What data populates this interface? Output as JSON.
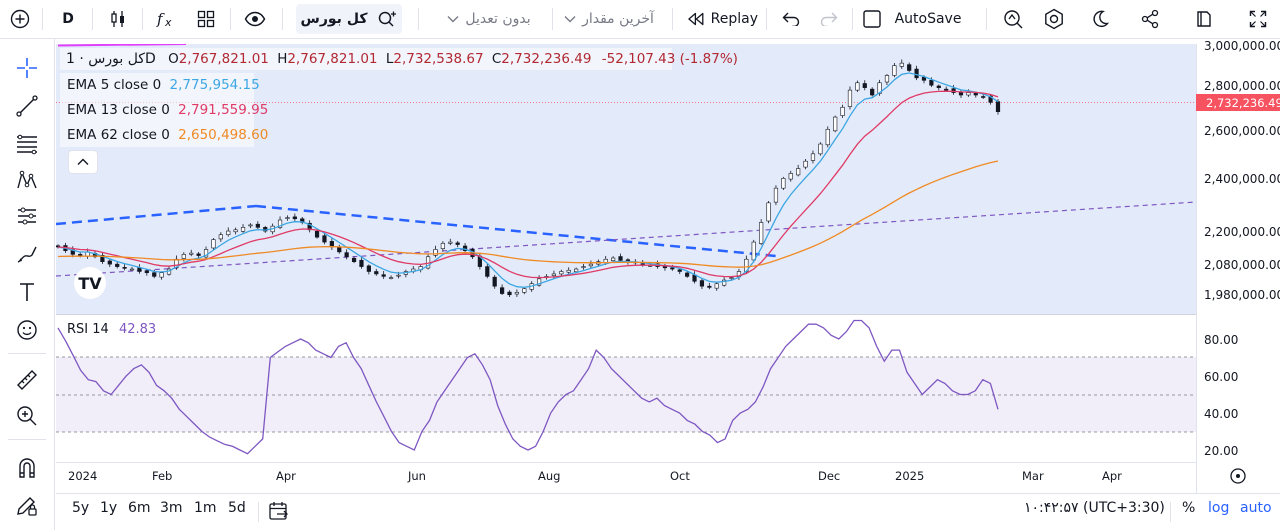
{
  "toolbar": {
    "interval": "D",
    "symbol": "کل بورس",
    "price_type": "بدون تعدیل",
    "last_value": "آخرین مقدار",
    "replay": "Replay",
    "autosave": "AutoSave"
  },
  "legend": {
    "title": "کل بورس · 1D",
    "ohlc": [
      {
        "label": "O",
        "value": "2,767,821.01"
      },
      {
        "label": "H",
        "value": "2,767,821.01"
      },
      {
        "label": "L",
        "value": "2,732,538.67"
      },
      {
        "label": "C",
        "value": "2,732,236.49"
      }
    ],
    "change": "-52,107.43 (-1.87%)",
    "ema": [
      {
        "label": "EMA 5 close 0",
        "value": "2,775,954.15",
        "color": "#3da7e3"
      },
      {
        "label": "EMA 13 close 0",
        "value": "2,791,559.95",
        "color": "#e03a66"
      },
      {
        "label": "EMA 62 close 0",
        "value": "2,650,498.60",
        "color": "#f08a24"
      }
    ]
  },
  "price_axis": [
    "3,000,000.00",
    "2,800,000.00",
    "2,600,000.00",
    "2,400,000.00",
    "2,200,000.00",
    "2,080,000.00",
    "1,980,000.00"
  ],
  "last_price": "2,732,236.49",
  "rsi": {
    "label": "RSI 14",
    "value": "42.83",
    "axis": [
      "80.00",
      "60.00",
      "40.00",
      "20.00"
    ]
  },
  "time_axis": [
    "2024",
    "Feb",
    "Apr",
    "Jun",
    "Aug",
    "Oct",
    "Dec",
    "2025",
    "Mar",
    "Apr"
  ],
  "ranges": [
    "5y",
    "1y",
    "6m",
    "3m",
    "1m",
    "5d"
  ],
  "clock": "۱۰:۴۲:۵۷ (UTC+3:30)",
  "scale_buttons": [
    "%",
    "log",
    "auto"
  ],
  "colors": {
    "up": "#26a69a",
    "down": "#ef5350",
    "trend": "#2962ff",
    "rsi": "#7e57c2",
    "accent": "#2962ff"
  },
  "chart_data": {
    "type": "candlestick",
    "price_series": [
      2180000,
      2165000,
      2150000,
      2145000,
      2160000,
      2140000,
      2120000,
      2110000,
      2100000,
      2095000,
      2090000,
      2080000,
      2075000,
      2060000,
      2075000,
      2090000,
      2130000,
      2150000,
      2155000,
      2145000,
      2170000,
      2210000,
      2230000,
      2245000,
      2250000,
      2260000,
      2270000,
      2260000,
      2245000,
      2265000,
      2290000,
      2300000,
      2295000,
      2280000,
      2250000,
      2220000,
      2200000,
      2180000,
      2160000,
      2140000,
      2120000,
      2100000,
      2080000,
      2070000,
      2060000,
      2055000,
      2065000,
      2080000,
      2090000,
      2100000,
      2140000,
      2170000,
      2195000,
      2200000,
      2190000,
      2165000,
      2140000,
      2100000,
      2060000,
      2020000,
      1990000,
      1985000,
      1995000,
      2010000,
      2030000,
      2050000,
      2060000,
      2070000,
      2080000,
      2085000,
      2090000,
      2100000,
      2110000,
      2120000,
      2130000,
      2135000,
      2125000,
      2120000,
      2115000,
      2110000,
      2105000,
      2100000,
      2095000,
      2090000,
      2080000,
      2060000,
      2040000,
      2020000,
      2015000,
      2030000,
      2045000,
      2055000,
      2080000,
      2130000,
      2200000,
      2280000,
      2360000,
      2420000,
      2460000,
      2480000,
      2500000,
      2530000,
      2560000,
      2600000,
      2660000,
      2710000,
      2750000,
      2820000,
      2850000,
      2830000,
      2800000,
      2850000,
      2880000,
      2920000,
      2930000,
      2900000,
      2870000,
      2860000,
      2840000,
      2830000,
      2820000,
      2810000,
      2800000,
      2810000,
      2800000,
      2790000,
      2770000,
      2732000
    ],
    "ema62_end": 2650498.6,
    "rsi_values": [
      86,
      79,
      71,
      63,
      58,
      57,
      52,
      50,
      55,
      60,
      64,
      66,
      62,
      55,
      52,
      48,
      42,
      38,
      34,
      30,
      27,
      25,
      23,
      22,
      20,
      18,
      22,
      26,
      70,
      73,
      76,
      78,
      80,
      78,
      74,
      72,
      70,
      76,
      78,
      70,
      64,
      55,
      46,
      38,
      30,
      24,
      22,
      20,
      30,
      36,
      46,
      52,
      58,
      64,
      70,
      72,
      66,
      58,
      44,
      34,
      26,
      22,
      20,
      22,
      30,
      40,
      46,
      50,
      52,
      58,
      64,
      74,
      70,
      64,
      60,
      56,
      52,
      48,
      46,
      48,
      44,
      42,
      40,
      36,
      34,
      30,
      28,
      24,
      26,
      36,
      40,
      42,
      46,
      54,
      64,
      70,
      76,
      80,
      84,
      88,
      88,
      86,
      82,
      80,
      84,
      90,
      90,
      86,
      76,
      68,
      74,
      74,
      62,
      56,
      50,
      54,
      58,
      56,
      52,
      50,
      50,
      52,
      58,
      56,
      42
    ],
    "rsi_levels": [
      70,
      50,
      30
    ],
    "ylabel": "",
    "xlabel": ""
  }
}
